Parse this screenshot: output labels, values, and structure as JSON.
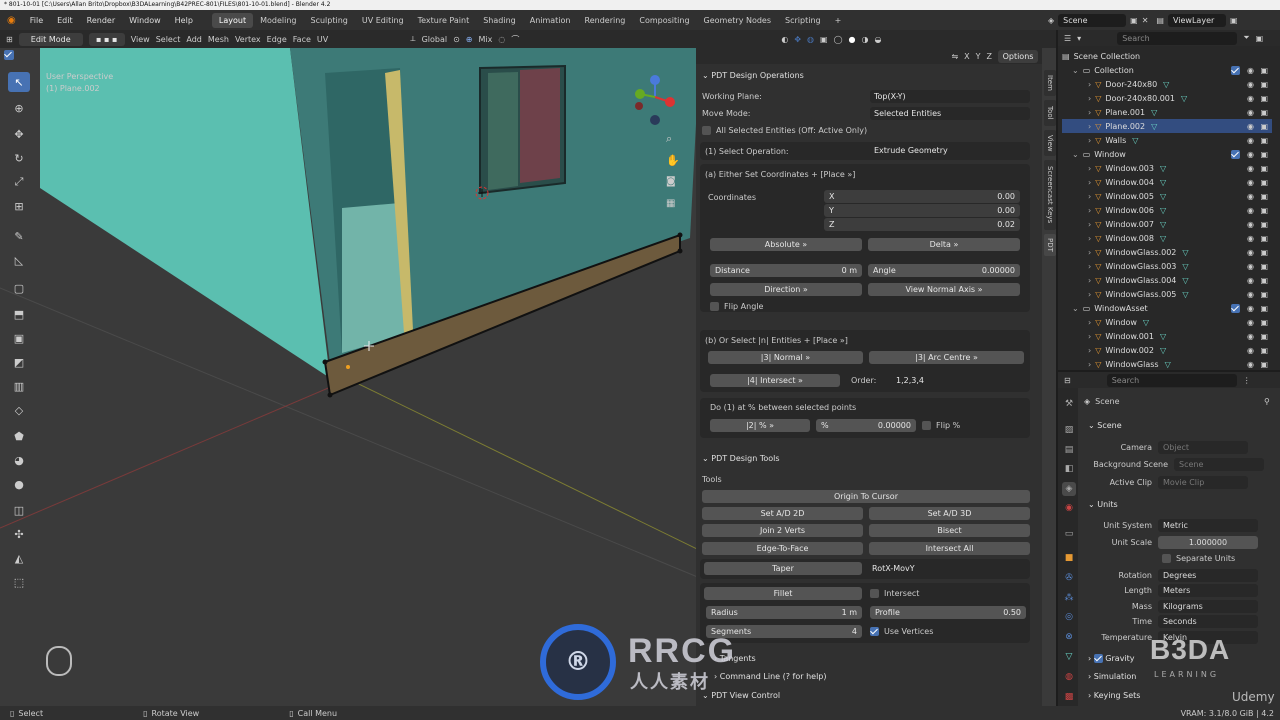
{
  "window_title": "* 801-10-01 [C:\\Users\\Allan Brito\\Dropbox\\B3DALearning\\B42PREC-801\\FILES\\801-10-01.blend] - Blender 4.2",
  "menu": [
    "File",
    "Edit",
    "Render",
    "Window",
    "Help"
  ],
  "workspaces": [
    "Layout",
    "Modeling",
    "Sculpting",
    "UV Editing",
    "Texture Paint",
    "Shading",
    "Animation",
    "Rendering",
    "Compositing",
    "Geometry Nodes",
    "Scripting"
  ],
  "scene_name": "Scene",
  "view_layer": "ViewLayer",
  "viewport_header": {
    "mode": "Edit Mode",
    "menus": [
      "View",
      "Select",
      "Add",
      "Mesh",
      "Vertex",
      "Edge",
      "Face",
      "UV"
    ],
    "orientation": "Global",
    "snap": "Mix",
    "axes": [
      "X",
      "Y",
      "Z"
    ],
    "options": "Options"
  },
  "viewport_info": {
    "line1": "User Perspective",
    "line2": "(1) Plane.002"
  },
  "side_tabs": [
    "Item",
    "Tool",
    "View",
    "Screencast Keys",
    "PDT"
  ],
  "pdt_ops": {
    "title": "PDT Design Operations",
    "working_plane_label": "Working Plane:",
    "working_plane_value": "Top(X-Y)",
    "move_mode_label": "Move Mode:",
    "move_mode_value": "Selected Entities",
    "all_selected_label": "All Selected Entities (Off: Active Only)",
    "select_op_label": "(1) Select Operation:",
    "select_op_value": "Extrude Geometry",
    "section_a": "(a) Either Set Coordinates + [Place »]",
    "coordinates_label": "Coordinates",
    "coords": [
      {
        "axis": "X",
        "value": "0.00"
      },
      {
        "axis": "Y",
        "value": "0.00"
      },
      {
        "axis": "Z",
        "value": "0.02"
      }
    ],
    "absolute": "Absolute »",
    "delta": "Delta »",
    "distance_label": "Distance",
    "distance_value": "0 m",
    "angle_label": "Angle",
    "angle_value": "0.00000",
    "direction": "Direction »",
    "view_normal": "View Normal Axis »",
    "flip_angle": "Flip Angle",
    "section_b": "(b) Or Select |n| Entities + [Place »]",
    "normal": "|3| Normal »",
    "arc_centre": "|3| Arc Centre »",
    "intersect": "|4| Intersect »",
    "order_label": "Order:",
    "order_value": "1,2,3,4",
    "section_pct": "Do (1) at % between selected points",
    "pct_btn": "|2| % »",
    "pct_label": "%",
    "pct_value": "0.00000",
    "flip_pct": "Flip %"
  },
  "pdt_tools": {
    "title": "PDT Design Tools",
    "tools_label": "Tools",
    "origin_to_cursor": "Origin To Cursor",
    "set_ad_2d": "Set A/D 2D",
    "set_ad_3d": "Set A/D 3D",
    "join_2_verts": "Join 2 Verts",
    "bisect": "Bisect",
    "edge_to_face": "Edge-To-Face",
    "intersect_all": "Intersect All",
    "taper": "Taper",
    "taper_value": "RotX-MovY",
    "fillet": "Fillet",
    "fillet_intersect": "Intersect",
    "radius_label": "Radius",
    "radius_value": "1 m",
    "profile_label": "Profile",
    "profile_value": "0.50",
    "segments_label": "Segments",
    "segments_value": "4",
    "use_vertices": "Use Vertices",
    "tangents": "Tangents",
    "command_line": "Command Line (? for help)",
    "view_control": "PDT View Control"
  },
  "outliner": {
    "search_placeholder": "Search",
    "root": "Scene Collection",
    "items": [
      {
        "name": "Collection",
        "level": 0,
        "type": "collection"
      },
      {
        "name": "Door-240x80",
        "level": 1,
        "type": "object"
      },
      {
        "name": "Door-240x80.001",
        "level": 1,
        "type": "object"
      },
      {
        "name": "Plane.001",
        "level": 1,
        "type": "object"
      },
      {
        "name": "Plane.002",
        "level": 1,
        "type": "object",
        "selected": true
      },
      {
        "name": "Walls",
        "level": 1,
        "type": "object"
      },
      {
        "name": "Window",
        "level": 0,
        "type": "collection"
      },
      {
        "name": "Window.003",
        "level": 1,
        "type": "object"
      },
      {
        "name": "Window.004",
        "level": 1,
        "type": "object"
      },
      {
        "name": "Window.005",
        "level": 1,
        "type": "object"
      },
      {
        "name": "Window.006",
        "level": 1,
        "type": "object"
      },
      {
        "name": "Window.007",
        "level": 1,
        "type": "object"
      },
      {
        "name": "Window.008",
        "level": 1,
        "type": "object"
      },
      {
        "name": "WindowGlass.002",
        "level": 1,
        "type": "object"
      },
      {
        "name": "WindowGlass.003",
        "level": 1,
        "type": "object"
      },
      {
        "name": "WindowGlass.004",
        "level": 1,
        "type": "object"
      },
      {
        "name": "WindowGlass.005",
        "level": 1,
        "type": "object"
      },
      {
        "name": "WindowAsset",
        "level": 0,
        "type": "collection"
      },
      {
        "name": "Window",
        "level": 1,
        "type": "object"
      },
      {
        "name": "Window.001",
        "level": 1,
        "type": "object"
      },
      {
        "name": "Window.002",
        "level": 1,
        "type": "object"
      },
      {
        "name": "WindowGlass",
        "level": 1,
        "type": "object"
      }
    ]
  },
  "properties": {
    "search_placeholder": "Search",
    "context": "Scene",
    "scene_panel": "Scene",
    "camera_label": "Camera",
    "camera_placeholder": "Object",
    "bg_scene_label": "Background Scene",
    "bg_scene_placeholder": "Scene",
    "active_clip_label": "Active Clip",
    "active_clip_placeholder": "Movie Clip",
    "units_panel": "Units",
    "unit_system_label": "Unit System",
    "unit_system": "Metric",
    "unit_scale_label": "Unit Scale",
    "unit_scale": "1.000000",
    "separate_units": "Separate Units",
    "rotation_label": "Rotation",
    "rotation": "Degrees",
    "length_label": "Length",
    "length": "Meters",
    "mass_label": "Mass",
    "mass": "Kilograms",
    "time_label": "Time",
    "time": "Seconds",
    "temperature_label": "Temperature",
    "temperature": "Kelvin",
    "gravity": "Gravity",
    "simulation": "Simulation",
    "keying_sets": "Keying Sets"
  },
  "status_bar": {
    "select": "Select",
    "rotate": "Rotate View",
    "call_menu": "Call Menu",
    "vram": "VRAM: 3.1/8.0 GiB | 4.2"
  },
  "watermarks": {
    "rrcg": "RRCG",
    "rrcg_sub": "人人素材",
    "b3da": "B3DA",
    "b3da_sub": "LEARNING",
    "udemy": "Udemy"
  },
  "colors": {
    "accent": "#4772b3",
    "wall": "#5bbfb0",
    "selected_row": "#334d80"
  }
}
